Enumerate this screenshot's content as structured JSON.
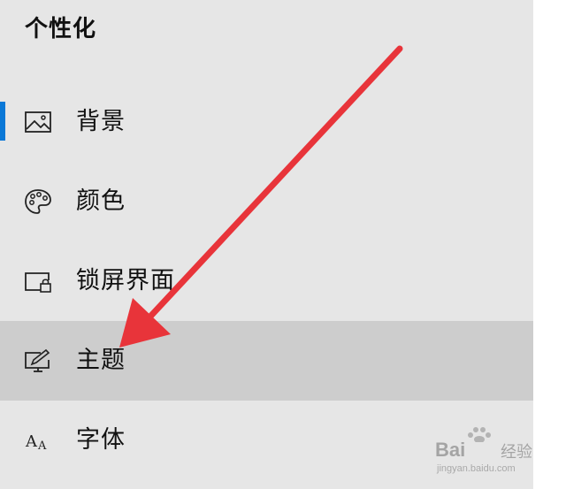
{
  "settings": {
    "section_title": "个性化",
    "items": [
      {
        "label": "背景",
        "icon": "image-icon"
      },
      {
        "label": "颜色",
        "icon": "palette-icon"
      },
      {
        "label": "锁屏界面",
        "icon": "lock-screen-icon"
      },
      {
        "label": "主题",
        "icon": "theme-icon"
      },
      {
        "label": "字体",
        "icon": "font-icon"
      }
    ],
    "active_index": 0,
    "highlighted_index": 3
  },
  "watermark": {
    "brand": "Bai",
    "brand_suffix": "经验",
    "domain": "jingyan.baidu.com"
  },
  "colors": {
    "pane_background": "#e6e6e6",
    "highlight_background": "#cdcdcd",
    "accent": "#0a78d7",
    "arrow": "#e8343a"
  }
}
